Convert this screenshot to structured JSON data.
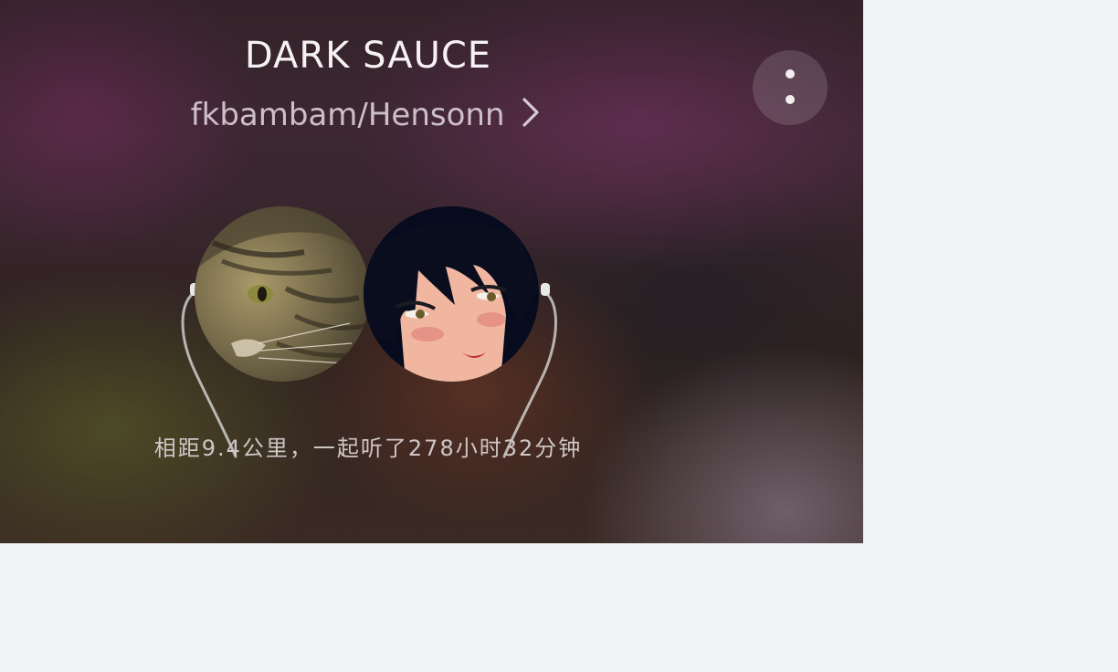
{
  "song": {
    "title": "DARK SAUCE",
    "artists": "fkbambam/Hensonn"
  },
  "header": {
    "more_icon": "vertical-dots-icon",
    "artist_chevron_icon": "chevron-right-icon"
  },
  "listeners": {
    "left_avatar": "cat-avatar",
    "right_avatar": "anime-girl-avatar",
    "stats_text": "相距9.4公里，一起听了278小时32分钟"
  },
  "colors": {
    "page_background": "#f3f4f6",
    "title_text": "#f6f2f4",
    "subtitle_text": "#cdbfc8",
    "stats_text": "#cfc6c6"
  }
}
